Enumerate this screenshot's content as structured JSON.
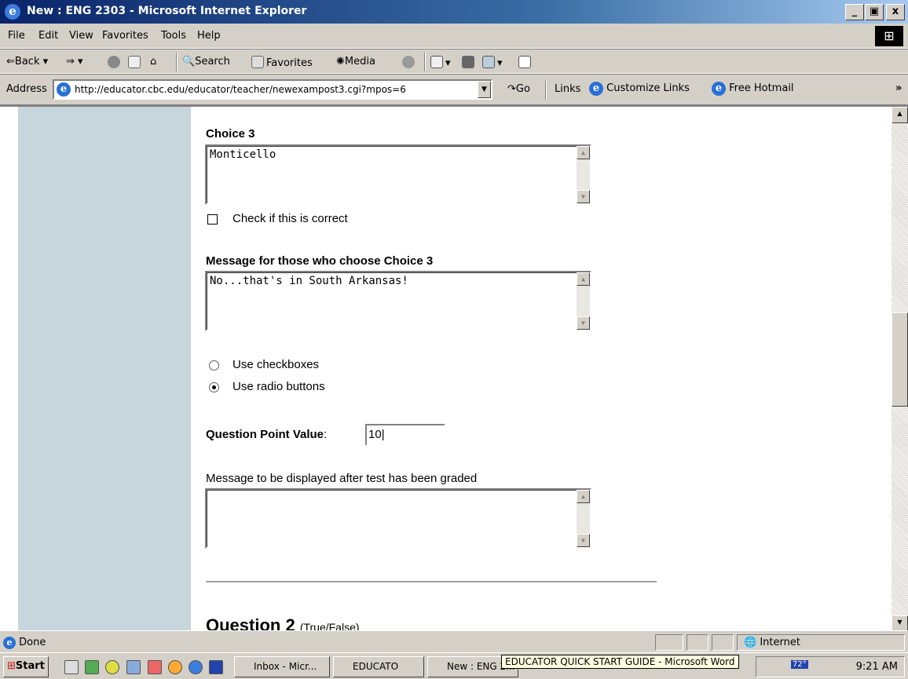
{
  "window": {
    "title": "New : ENG 2303 - Microsoft Internet Explorer",
    "min": "_",
    "max": "2",
    "close": "x"
  },
  "menu": [
    "File",
    "Edit",
    "View",
    "Favorites",
    "Tools",
    "Help"
  ],
  "toolbar": {
    "back": "Back",
    "search": "Search",
    "favorites": "Favorites",
    "media": "Media"
  },
  "address": {
    "label": "Address",
    "url": "http://educator.cbc.edu/educator/teacher/newexampost3.cgi?mpos=6",
    "go": "Go",
    "links": "Links",
    "customize": "Customize Links",
    "hotmail": "Free Hotmail"
  },
  "form": {
    "choice_label": "Choice 3",
    "choice_value": "Monticello",
    "correct_label": "Check if this is correct",
    "message_label": "Message for those who choose Choice 3",
    "message_value": "No...that's in South Arkansas!",
    "use_checkboxes": "Use checkboxes",
    "use_radio": "Use radio buttons",
    "selected_mode": "radio",
    "points_label": "Question Point Value",
    "points_colon": ":",
    "points_value": "10",
    "graded_label": "Message to be displayed after test has been graded",
    "graded_value": "",
    "next_question": "Question 2",
    "next_type": "(True/False)"
  },
  "status": {
    "text": "Done",
    "zone": "Internet"
  },
  "taskbar": {
    "start": "Start",
    "tasks": [
      "Inbox - Micr...",
      "EDUCATO",
      "New : ENG 2..."
    ],
    "tooltip": "EDUCATOR QUICK START GUIDE - Microsoft Word",
    "temp": "72°",
    "clock": "9:21 AM"
  },
  "colors": {
    "title_start": "#0a246a",
    "sidebar": "#c6d6dc"
  }
}
